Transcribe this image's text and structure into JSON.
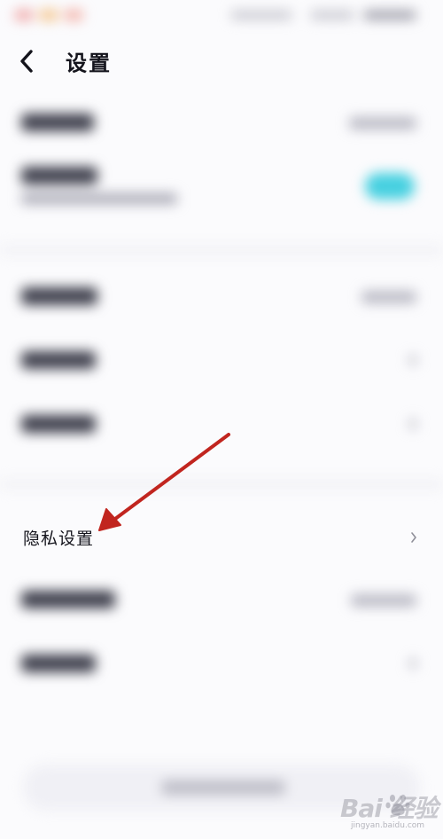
{
  "header": {
    "title": "设置",
    "back_icon": "chevron-left-icon"
  },
  "privacy_row": {
    "label": "隐私设置",
    "chevron_icon": "chevron-right-icon"
  },
  "annotation": {
    "color": "#c1251f",
    "shape": "arrow"
  },
  "toggle": {
    "state": "on",
    "color": "#46d0e0"
  },
  "watermark": {
    "brand": "Bai 经验",
    "domain": "jingyan.baidu.com",
    "icon": "baidu-paw-icon"
  }
}
